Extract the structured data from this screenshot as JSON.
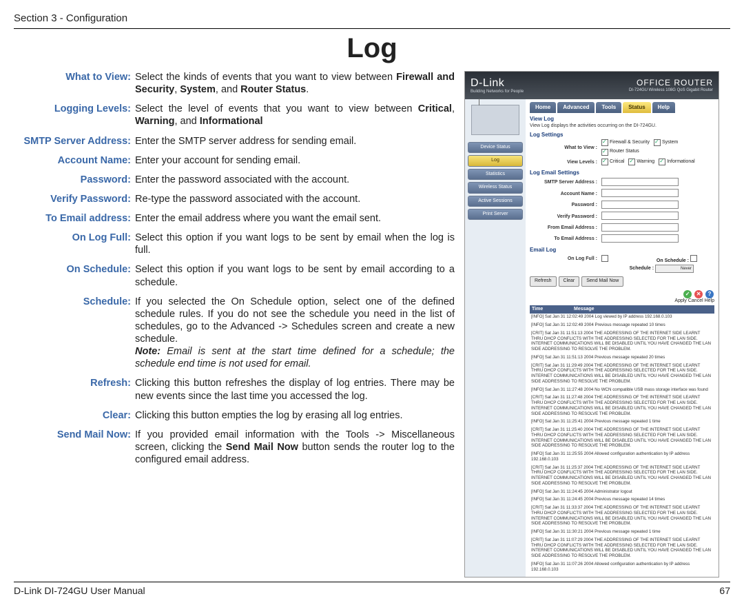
{
  "header": {
    "section": "Section 3 - Configuration"
  },
  "page_title": "Log",
  "defs": [
    {
      "label": "What to View:",
      "html": "Select the kinds of events that you want to view between <b>Firewall and Security</b>, <b>System</b>, and <b>Router Status</b>."
    },
    {
      "label": "Logging Levels:",
      "html": "Select the level of events that you want to view between <b>Critical</b>, <b>Warning</b>, and <b>Informational</b>"
    },
    {
      "label": "SMTP Server Address:",
      "html": "Enter the SMTP server address for sending email."
    },
    {
      "label": "Account Name:",
      "html": "Enter your account for sending email."
    },
    {
      "label": "Password:",
      "html": "Enter the password associated with the account."
    },
    {
      "label": "Verify Password:",
      "html": "Re-type the password associated with the account."
    },
    {
      "label": "To Email address:",
      "html": "Enter the email address where you want the email sent."
    },
    {
      "label": "On Log Full:",
      "html": "Select this option if you want logs to be sent by email when the log is full."
    },
    {
      "label": "On Schedule:",
      "html": "Select this option if you want logs to be sent by email according to a schedule."
    },
    {
      "label": "Schedule:",
      "html": "If you selected the On Schedule option, select one of the defined schedule rules. If you do not see the schedule you need in the list of schedules, go to the Advanced -> Schedules screen and create a new schedule.<br><i><b>Note:</b> Email is sent at the start time defined for a schedule; the schedule end time is not used for email.</i>"
    },
    {
      "label": "Refresh:",
      "html": "Clicking this button refreshes the display of log entries. There may be new events since the last time you accessed the log."
    },
    {
      "label": "Clear:",
      "html": "Clicking this button empties the log by erasing all log entries."
    },
    {
      "label": "Send Mail Now:",
      "html": "If you provided email information with the Tools -> Miscellaneous screen, clicking the <b>Send Mail Now</b> button sends the router log to the configured email address."
    }
  ],
  "screenshot": {
    "brand": "D-Link",
    "brand_sub": "Building Networks for People",
    "device_title": "OFFICE ROUTER",
    "device_sub": "DI-724GU Wireless 108G QoS Gigabit Router",
    "sidebar": [
      {
        "label": "Device Status",
        "active": false
      },
      {
        "label": "Log",
        "active": true
      },
      {
        "label": "Statistics",
        "active": false
      },
      {
        "label": "Wireless Status",
        "active": false
      },
      {
        "label": "Active Sessions",
        "active": false
      },
      {
        "label": "Print Server",
        "active": false
      }
    ],
    "tabs": [
      "Home",
      "Advanced",
      "Tools",
      "Status",
      "Help"
    ],
    "active_tab": 3,
    "view_log_title": "View Log",
    "view_log_desc": "View Log displays the activities occurring on the DI-724GU.",
    "log_settings_title": "Log Settings",
    "what_to_view_label": "What to View :",
    "what_to_view_opts": [
      "Firewall & Security",
      "System",
      "Router Status"
    ],
    "view_levels_label": "View Levels :",
    "view_levels_opts": [
      "Critical",
      "Warning",
      "Informational"
    ],
    "email_settings_title": "Log Email Settings",
    "email_fields": [
      "SMTP Server Address :",
      "Account Name :",
      "Password :",
      "Verify Password :",
      "From Email Address :",
      "To Email Address :"
    ],
    "email_log_title": "Email Log",
    "on_log_full_label": "On Log Full :",
    "on_schedule_label": "On Schedule :",
    "schedule_label": "Schedule :",
    "schedule_value": "Never",
    "buttons": [
      "Refresh",
      "Clear",
      "Send Mail Now"
    ],
    "apply_labels": "Apply Cancel Help",
    "table_headers": [
      "Time",
      "Message"
    ],
    "log_entries": [
      "[INFO] Sat Jan 31 12:02:49 2004 Log viewed by IP address 192.168.0.103",
      "[INFO] Sat Jan 31 12:02:49 2004 Previous message repeated 10 times",
      "[CRIT] Sat Jan 31 11:51:13 2004 THE ADDRESSING OF THE INTERNET SIDE LEARNT THRU DHCP CONFLICTS WITH THE ADDRESSING SELECTED FOR THE LAN SIDE. INTERNET COMMUNICATIONS WILL BE DISABLED UNTIL YOU HAVE CHANGED THE LAN SIDE ADDRESSING TO RESOLVE THE PROBLEM.",
      "[INFO] Sat Jan 31 11:51:13 2004 Previous message repeated 20 times",
      "[CRIT] Sat Jan 31 11:29:49 2004 THE ADDRESSING OF THE INTERNET SIDE LEARNT THRU DHCP CONFLICTS WITH THE ADDRESSING SELECTED FOR THE LAN SIDE. INTERNET COMMUNICATIONS WILL BE DISABLED UNTIL YOU HAVE CHANGED THE LAN SIDE ADDRESSING TO RESOLVE THE PROBLEM.",
      "[INFO] Sat Jan 31 11:27:48 2004 No WCN compatible USB mass storage interface was found",
      "[CRIT] Sat Jan 31 11:27:48 2004 THE ADDRESSING OF THE INTERNET SIDE LEARNT THRU DHCP CONFLICTS WITH THE ADDRESSING SELECTED FOR THE LAN SIDE. INTERNET COMMUNICATIONS WILL BE DISABLED UNTIL YOU HAVE CHANGED THE LAN SIDE ADDRESSING TO RESOLVE THE PROBLEM.",
      "[INFO] Sat Jan 31 11:25:41 2004 Previous message repeated 1 time",
      "[CRIT] Sat Jan 31 11:25:40 2004 THE ADDRESSING OF THE INTERNET SIDE LEARNT THRU DHCP CONFLICTS WITH THE ADDRESSING SELECTED FOR THE LAN SIDE. INTERNET COMMUNICATIONS WILL BE DISABLED UNTIL YOU HAVE CHANGED THE LAN SIDE ADDRESSING TO RESOLVE THE PROBLEM.",
      "[INFO] Sat Jan 31 11:25:55 2004 Allowed configuration authentication by IP address 192.168.0.103",
      "[CRIT] Sat Jan 31 11:25:37 2004 THE ADDRESSING OF THE INTERNET SIDE LEARNT THRU DHCP CONFLICTS WITH THE ADDRESSING SELECTED FOR THE LAN SIDE. INTERNET COMMUNICATIONS WILL BE DISABLED UNTIL YOU HAVE CHANGED THE LAN SIDE ADDRESSING TO RESOLVE THE PROBLEM.",
      "[INFO] Sat Jan 31 11:24:45 2004 Administrator logout",
      "[INFO] Sat Jan 31 11:24:45 2004 Previous message repeated 14 times",
      "[CRIT] Sat Jan 31 11:33:37 2004 THE ADDRESSING OF THE INTERNET SIDE LEARNT THRU DHCP CONFLICTS WITH THE ADDRESSING SELECTED FOR THE LAN SIDE. INTERNET COMMUNICATIONS WILL BE DISABLED UNTIL YOU HAVE CHANGED THE LAN SIDE ADDRESSING TO RESOLVE THE PROBLEM.",
      "[INFO] Sat Jan 31 11:30:21 2004 Previous message repeated 1 time",
      "[CRIT] Sat Jan 31 11:07:29 2004 THE ADDRESSING OF THE INTERNET SIDE LEARNT THRU DHCP CONFLICTS WITH THE ADDRESSING SELECTED FOR THE LAN SIDE. INTERNET COMMUNICATIONS WILL BE DISABLED UNTIL YOU HAVE CHANGED THE LAN SIDE ADDRESSING TO RESOLVE THE PROBLEM.",
      "[INFO] Sat Jan 31 11:07:26 2004 Allowed configuration authentication by IP address 192.168.0.103"
    ]
  },
  "footer": {
    "left": "D-Link DI-724GU User Manual",
    "right": "67"
  }
}
